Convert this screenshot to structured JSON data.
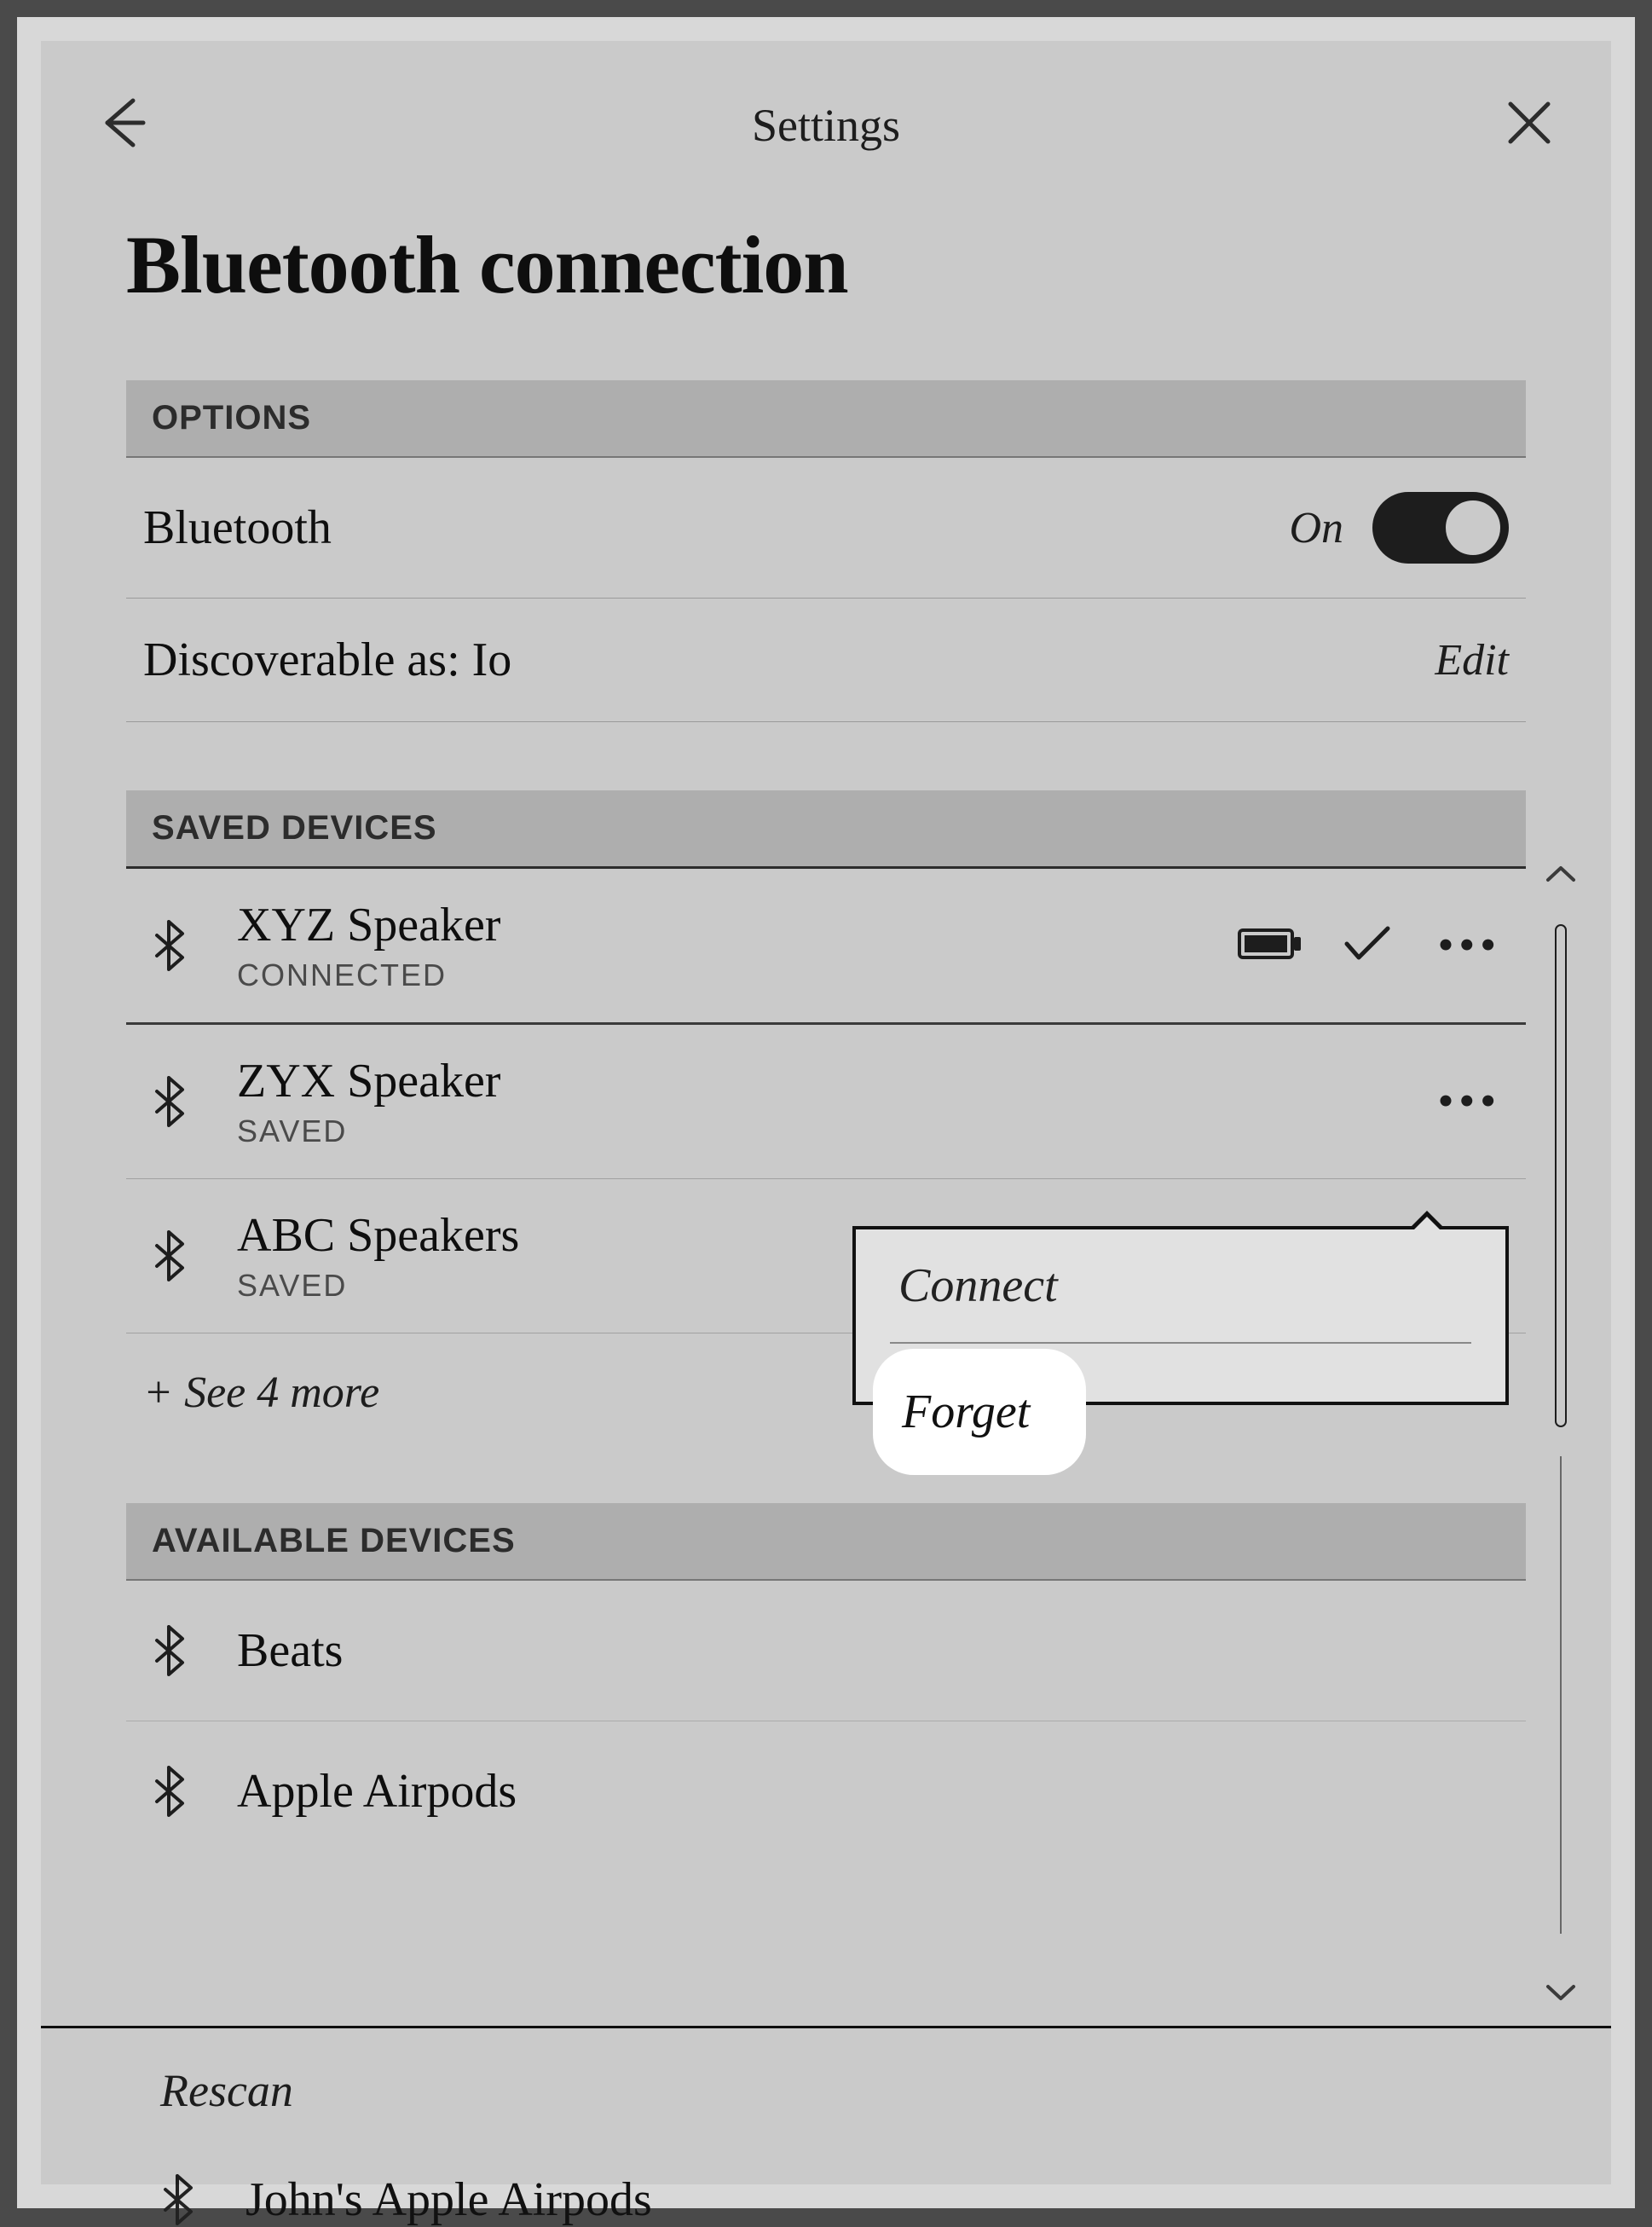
{
  "header": {
    "title": "Settings"
  },
  "page_title": "Bluetooth connection",
  "sections": {
    "options_label": "OPTIONS",
    "saved_label": "SAVED DEVICES",
    "available_label": "AVAILABLE DEVICES"
  },
  "options": {
    "bluetooth_label": "Bluetooth",
    "bluetooth_state": "On",
    "discoverable_label": "Discoverable as: Io",
    "edit_label": "Edit"
  },
  "saved_devices": [
    {
      "name": "XYZ Speaker",
      "status": "CONNECTED",
      "has_battery": true,
      "has_check": true,
      "has_more": true
    },
    {
      "name": "ZYX Speaker",
      "status": "SAVED",
      "has_battery": false,
      "has_check": false,
      "has_more": true
    },
    {
      "name": "ABC Speakers",
      "status": "SAVED",
      "has_battery": false,
      "has_check": false,
      "has_more": false
    }
  ],
  "see_more_label": "+ See 4 more",
  "available_devices": [
    {
      "name": "Beats"
    },
    {
      "name": "Apple Airpods"
    },
    {
      "name": "John's Apple Airpods"
    }
  ],
  "popup": {
    "connect_label": "Connect",
    "forget_label": "Forget"
  },
  "rescan_label": "Rescan"
}
